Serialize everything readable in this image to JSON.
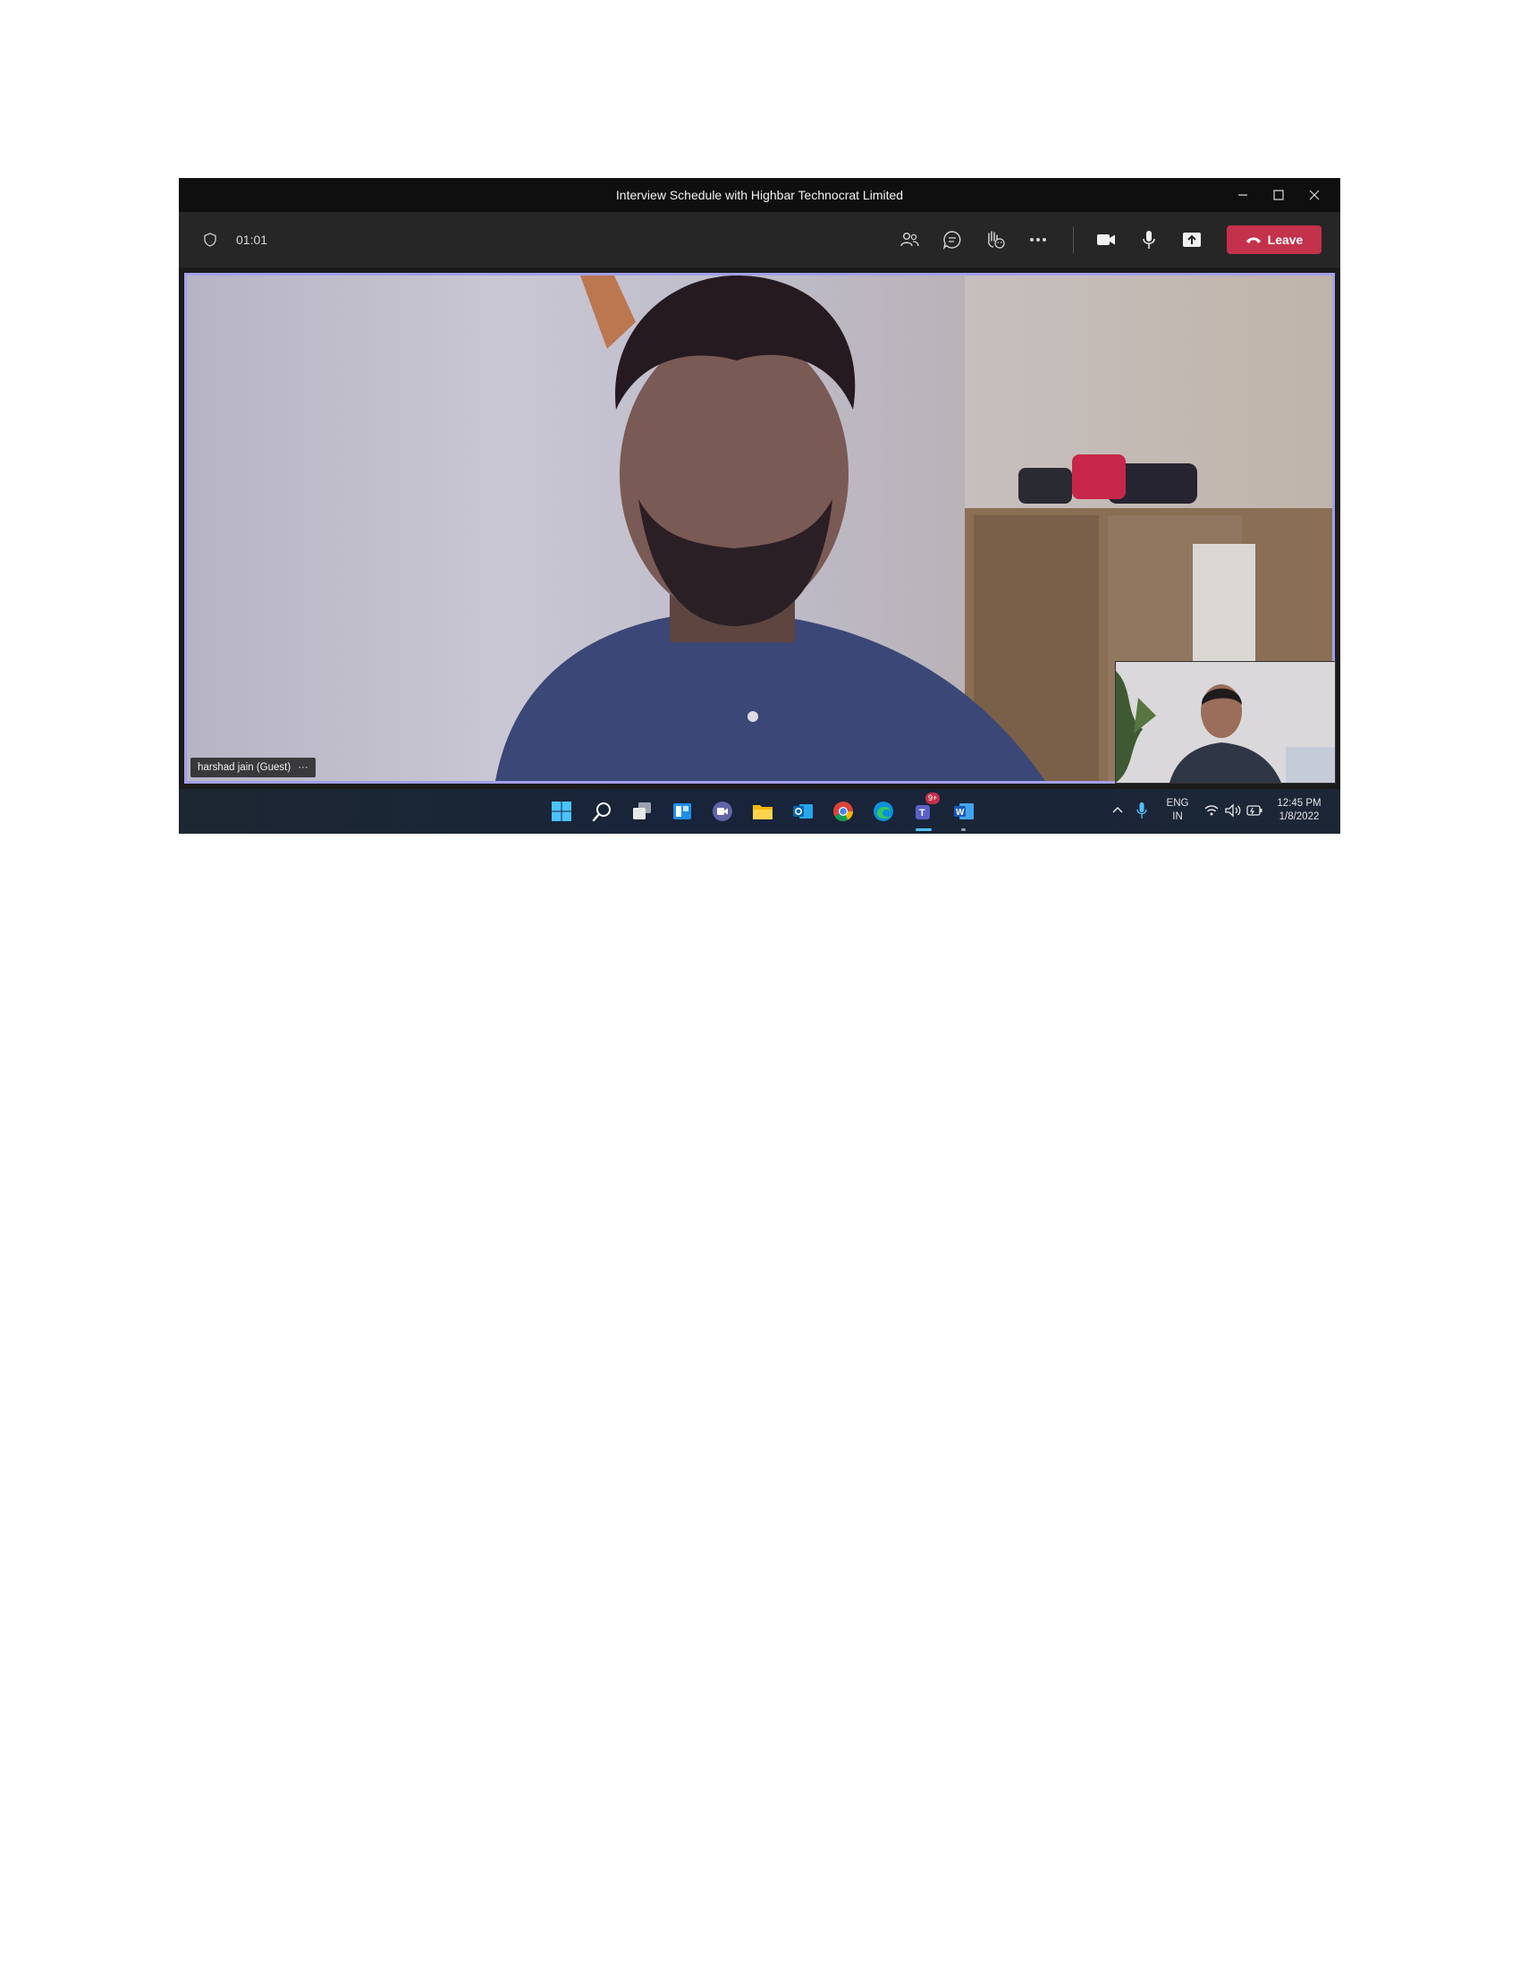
{
  "window": {
    "title": "Interview Schedule with Highbar Technocrat Limited",
    "controls": [
      "minimize-icon",
      "maximize-icon",
      "close-icon"
    ]
  },
  "toolbar": {
    "timer": "01:01",
    "icons": [
      "shield-icon",
      "participants-icon",
      "chat-icon",
      "reactions-icon",
      "more-options-icon",
      "camera-icon",
      "microphone-icon",
      "share-screen-icon"
    ],
    "leave_label": "Leave",
    "leave_color": "#c4314b"
  },
  "stage": {
    "participant_name": "harshad jain (Guest)",
    "more_glyph": "···",
    "active_speaker_border": "#a3a0e8"
  },
  "taskbar": {
    "apps": [
      "windows-start-icon",
      "search-icon",
      "task-view-icon",
      "widgets-icon",
      "teams-chat-icon",
      "file-explorer-icon",
      "outlook-icon",
      "chrome-icon",
      "edge-icon",
      "teams-icon",
      "word-icon"
    ],
    "teams_badge": "9+",
    "language": "ENG",
    "region": "IN",
    "time": "12:45 PM",
    "date": "1/8/2022"
  }
}
